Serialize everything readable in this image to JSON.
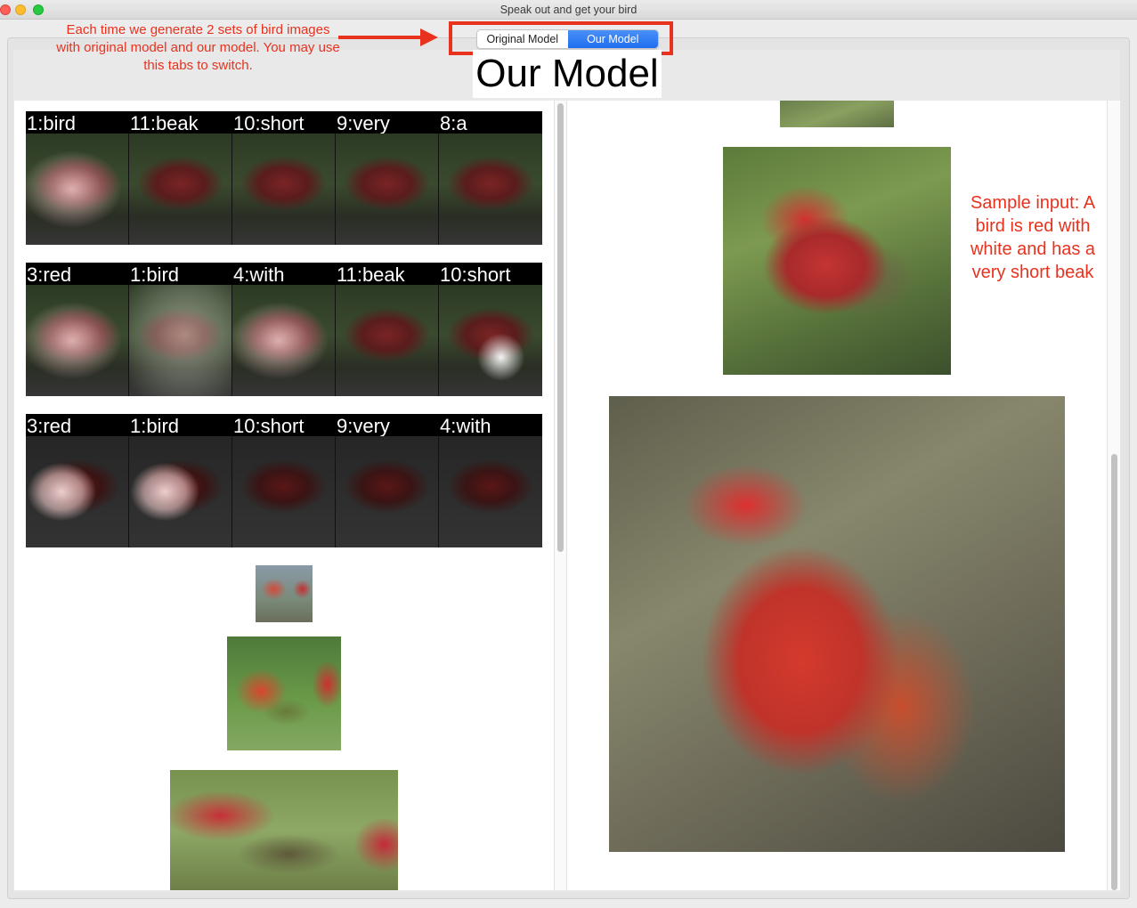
{
  "window": {
    "title": "Speak out and get your bird"
  },
  "annotation": {
    "text": "Each time we generate 2 sets of bird images with original model and our model. You may use this tabs to switch."
  },
  "tabs": [
    {
      "label": "Original Model",
      "active": false
    },
    {
      "label": "Our Model",
      "active": true
    }
  ],
  "heading": "Our Model",
  "attention_rows": [
    {
      "labels": [
        "1:bird",
        "11:beak",
        "10:short",
        "9:very",
        "8:a"
      ]
    },
    {
      "labels": [
        "3:red",
        "1:bird",
        "4:with",
        "11:beak",
        "10:short"
      ]
    },
    {
      "labels": [
        "3:red",
        "1:bird",
        "10:short",
        "9:very",
        "4:with"
      ]
    }
  ],
  "sample_input": "Sample input: A bird is red with white and has a very short beak",
  "colors": {
    "annotation": "#e8321e",
    "tab_active": "#1e6ef0"
  }
}
